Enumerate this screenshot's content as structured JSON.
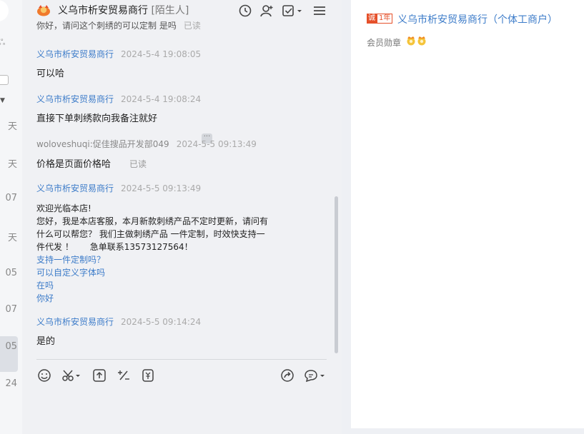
{
  "left": {
    "stamps": [
      "天",
      "天",
      "07",
      "天",
      "05",
      "07",
      "05",
      "24"
    ]
  },
  "header": {
    "title": "义乌市析安贸易商行",
    "tag": "[陌生人]",
    "icons": [
      "refresh-icon",
      "user-icon",
      "task-check-icon",
      "menu-icon"
    ]
  },
  "messages": {
    "cut_text": "你好，请问这个刺绣的可以定制 是吗",
    "cut_read": "已读",
    "list": [
      {
        "name": "义乌市析安贸易商行",
        "time": "2024-5-4 19:08:05",
        "text": "可以哈"
      },
      {
        "name": "义乌市析安贸易商行",
        "time": "2024-5-4 19:08:24",
        "text": "直接下单刺绣款向我备注就好"
      },
      {
        "name": "woloveshuqi:促佳搜品开发部049",
        "time": "2024-5-5 09:13:49",
        "text": "价格是页面价格哈",
        "read": "已读"
      },
      {
        "name": "义乌市析安贸易商行",
        "time": "2024-5-5 09:13:49",
        "lines": [
          "欢迎光临本店!",
          "您好，我是本店客服，本月新款刺绣产品不定时更新，请问有",
          "什么可以帮您？ 我们主做刺绣产品 一件定制，时效快支持一",
          "件代发 ！      急单联系13573127564！"
        ],
        "links": [
          "支持一件定制吗？",
          "可以自定义字体吗",
          "在吗",
          "你好"
        ]
      },
      {
        "name": "义乌市析安贸易商行",
        "time": "2024-5-5 09:14:24",
        "text": "是的"
      }
    ]
  },
  "toolbar": {
    "icons": [
      "emoji-icon",
      "scissors-icon",
      "upload-icon",
      "discount-icon",
      "coupon-icon",
      "share-icon",
      "quick-reply-icon"
    ]
  },
  "right": {
    "badge_left": "诚",
    "badge_right": "1年",
    "shop_name": "义乌市析安贸易商行（个体工商户）",
    "medal_label": "会员勋章"
  },
  "colors": {
    "accent": "#3d7cc9",
    "badge": "#e5502a"
  }
}
